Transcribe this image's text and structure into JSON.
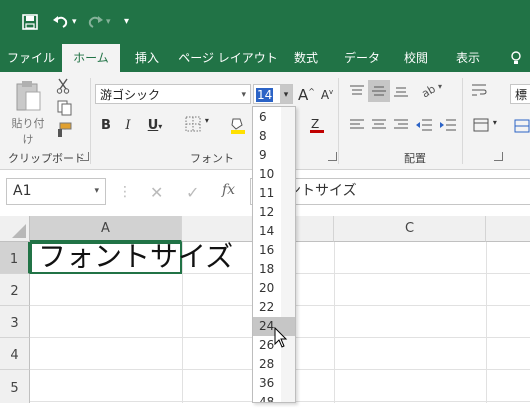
{
  "colors": {
    "brand": "#217346",
    "ribbon": "#f3f3f3"
  },
  "qat": {
    "save_icon": "save-icon",
    "undo_icon": "undo-icon",
    "redo_icon": "redo-icon",
    "customize_icon": "customize-icon"
  },
  "tabs": [
    {
      "label": "ファイル"
    },
    {
      "label": "ホーム"
    },
    {
      "label": "挿入"
    },
    {
      "label": "ページ レイアウト"
    },
    {
      "label": "数式"
    },
    {
      "label": "データ"
    },
    {
      "label": "校閲"
    },
    {
      "label": "表示"
    }
  ],
  "ribbon": {
    "clipboard": {
      "label": "クリップボード",
      "paste_label": "貼り付け"
    },
    "font": {
      "label": "フォント",
      "font_name": "游ゴシック",
      "font_size": "14",
      "bold": "B",
      "italic": "I",
      "underline": "U",
      "grow": "A",
      "shrink": "A"
    },
    "alignment": {
      "label": "配置"
    },
    "partial_font": "標"
  },
  "formula_bar": {
    "name_box": "A1",
    "fx": "fx",
    "content": "フォントサイズ"
  },
  "grid": {
    "columns": [
      "A",
      "B",
      "C"
    ],
    "rows": [
      "1",
      "2",
      "3",
      "4",
      "5"
    ],
    "a1_text": "フォントサイズ"
  },
  "dropdown": {
    "items": [
      "6",
      "8",
      "9",
      "10",
      "11",
      "12",
      "14",
      "16",
      "18",
      "20",
      "22",
      "24",
      "26",
      "28",
      "36",
      "48"
    ],
    "highlighted": "24"
  }
}
